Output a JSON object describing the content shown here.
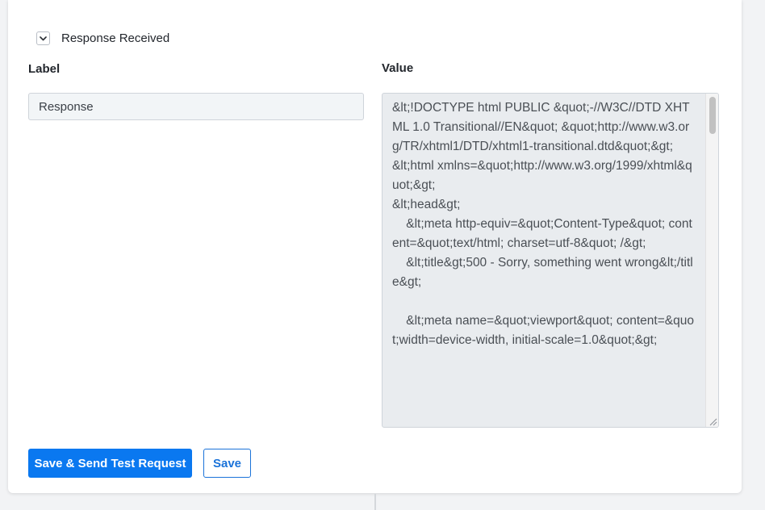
{
  "section": {
    "title": "Response Received",
    "collapse_icon": "chevron-down-icon"
  },
  "columns": {
    "label_header": "Label",
    "value_header": "Value"
  },
  "fields": {
    "label_value": "Response",
    "value_text": "&lt;!DOCTYPE html PUBLIC &quot;-//W3C//DTD XHTML 1.0 Transitional//EN&quot; &quot;http://www.w3.org/TR/xhtml1/DTD/xhtml1-transitional.dtd&quot;&gt;\n&lt;html xmlns=&quot;http://www.w3.org/1999/xhtml&quot;&gt;\n&lt;head&gt;\n    &lt;meta http-equiv=&quot;Content-Type&quot; content=&quot;text/html; charset=utf-8&quot; /&gt;\n    &lt;title&gt;500 - Sorry, something went wrong&lt;/title&gt;\n\n    &lt;meta name=&quot;viewport&quot; content=&quot;width=device-width, initial-scale=1.0&quot;&gt;"
  },
  "actions": {
    "primary_label": "Save & Send Test Request",
    "secondary_label": "Save"
  },
  "colors": {
    "primary": "#0a78f0",
    "secondary_border": "#1b73d9",
    "textarea_bg": "#e9ecef",
    "input_bg": "#f2f5f7"
  }
}
